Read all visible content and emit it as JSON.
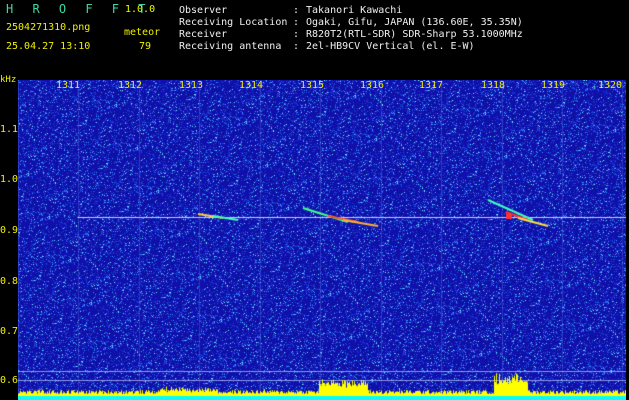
{
  "app": {
    "name": "H R O F F T",
    "version": "1.0.0"
  },
  "capture": {
    "filename": "2504271310.png",
    "timestamp": "25.04.27 13:10",
    "meteor_label": "meteor",
    "meteor_count": "79"
  },
  "info": [
    {
      "label": "Observer",
      "value": "Takanori Kawachi"
    },
    {
      "label": "Receiving Location",
      "value": "Ogaki, Gifu, JAPAN (136.60E, 35.35N)"
    },
    {
      "label": "Receiver",
      "value": "R820T2(RTL-SDR) SDR-Sharp 53.1000MHz"
    },
    {
      "label": "Receiving antenna",
      "value": "2el-HB9CV Vertical (el. E-W)"
    }
  ],
  "axis": {
    "y_unit": "kHz",
    "x_ticks": [
      "1311",
      "1312",
      "1313",
      "1314",
      "1315",
      "1316",
      "1317",
      "1318",
      "1319",
      "1320"
    ],
    "y_ticks": [
      "1.1",
      "1.0",
      "0.9",
      "0.8",
      "0.7",
      "0.6"
    ],
    "y_ticks_small": [
      "1.1",
      "1.0",
      "0.9",
      "0.8",
      "0.7",
      "0.6"
    ]
  },
  "colors": {
    "background": "#1010a0",
    "carrier": "#c8c8ff",
    "meteor": "#ff4040",
    "level_bar": "#ffff00",
    "baseline": "#00ffff"
  }
}
